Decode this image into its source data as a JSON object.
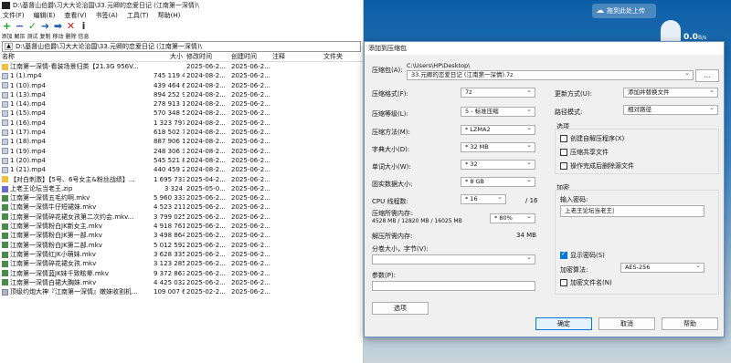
{
  "desktop": {
    "cloud_button": "拖到此处上传",
    "speed_value": "0.0",
    "speed_unit": "B/s"
  },
  "file_manager": {
    "title": "D:\\基督山伯爵\\习大大论治国\\33.元卿的恋爱日记 (江南第一深情)\\",
    "menus": [
      "文件(F)",
      "编辑(E)",
      "查看(V)",
      "书签(A)",
      "工具(T)",
      "帮助(H)"
    ],
    "tools": [
      {
        "label": "添加",
        "icon": "plus-icon",
        "color": "#1a9e1a"
      },
      {
        "label": "解压",
        "icon": "minus-icon",
        "color": "#2a4fb8"
      },
      {
        "label": "测试",
        "icon": "check-icon",
        "color": "#2ea02e"
      },
      {
        "label": "复制",
        "icon": "copy-arrow-icon",
        "color": "#1f5fb0"
      },
      {
        "label": "移动",
        "icon": "move-arrow-icon",
        "color": "#1f5fb0"
      },
      {
        "label": "删除",
        "icon": "delete-icon",
        "color": "#d01818"
      },
      {
        "label": "信息",
        "icon": "info-icon",
        "color": "#333333"
      }
    ],
    "path": "D:\\基督山伯爵\\习大大论治国\\33.元卿的恋爱日记 (江南第一深情)\\",
    "columns": {
      "name": "名称",
      "size": "大小",
      "modified": "修改时间",
      "created": "创建时间",
      "comment": "注释",
      "folders": "文件夹"
    },
    "rows": [
      {
        "icon": "folder",
        "name": "江南第一深情-看装场景归类【21.3G 956V...",
        "size": "",
        "modified": "2025-06-2...",
        "created": "2025-06-2..."
      },
      {
        "icon": "mp4",
        "name": "1 (1).mp4",
        "size": "745 119 4...",
        "modified": "2024-08-2...",
        "created": "2025-06-2..."
      },
      {
        "icon": "mp4",
        "name": "1 (10).mp4",
        "size": "439 464 6...",
        "modified": "2024-08-2...",
        "created": "2025-06-2..."
      },
      {
        "icon": "mp4",
        "name": "1 (13).mp4",
        "size": "894 252 9...",
        "modified": "2024-08-2...",
        "created": "2025-06-2..."
      },
      {
        "icon": "mp4",
        "name": "1 (14).mp4",
        "size": "278 913 1...",
        "modified": "2024-08-2...",
        "created": "2025-06-2..."
      },
      {
        "icon": "mp4",
        "name": "1 (15).mp4",
        "size": "570 348 5...",
        "modified": "2024-08-2...",
        "created": "2025-06-2..."
      },
      {
        "icon": "mp4",
        "name": "1 (16).mp4",
        "size": "1 323 797 ...",
        "modified": "2024-08-2...",
        "created": "2025-06-2..."
      },
      {
        "icon": "mp4",
        "name": "1 (17).mp4",
        "size": "618 502 7...",
        "modified": "2024-08-2...",
        "created": "2025-06-2..."
      },
      {
        "icon": "mp4",
        "name": "1 (18).mp4",
        "size": "887 906 1...",
        "modified": "2024-08-2...",
        "created": "2025-06-2..."
      },
      {
        "icon": "mp4",
        "name": "1 (19).mp4",
        "size": "248 306 3...",
        "modified": "2024-08-2...",
        "created": "2025-06-2..."
      },
      {
        "icon": "mp4",
        "name": "1 (20).mp4",
        "size": "545 521 8...",
        "modified": "2024-08-2...",
        "created": "2025-06-2..."
      },
      {
        "icon": "mp4",
        "name": "1 (21).mp4",
        "size": "440 459 2...",
        "modified": "2024-08-2...",
        "created": "2025-06-2..."
      },
      {
        "icon": "folder",
        "name": "【对白刺激】【5号、6号女主&粉丝战绩】...",
        "size": "1 695 733 ...",
        "modified": "2025-04-2...",
        "created": "2025-06-2..."
      },
      {
        "icon": "zip",
        "name": "上老王论坛当老王.zip",
        "size": "3 324",
        "modified": "2025-05-0...",
        "created": "2025-06-2..."
      },
      {
        "icon": "mkv",
        "name": "江南第一深情五毛约啊.mkv",
        "size": "5 960 333 ...",
        "modified": "2025-06-2...",
        "created": "2025-06-2..."
      },
      {
        "icon": "mkv",
        "name": "江南第一深情牛仔短裙妹.mkv",
        "size": "4 523 211 ...",
        "modified": "2025-06-2...",
        "created": "2025-06-2..."
      },
      {
        "icon": "mkv",
        "name": "江南第一深情碎花裙女孩第二次约会.mkv...",
        "size": "3 799 025 ...",
        "modified": "2025-06-2...",
        "created": "2025-06-2..."
      },
      {
        "icon": "mkv",
        "name": "江南第一深情粉白JK新女主.mkv",
        "size": "4 918 761 ...",
        "modified": "2025-06-2...",
        "created": "2025-06-2..."
      },
      {
        "icon": "mkv",
        "name": "江南第一深情粉白JK第一部.mkv",
        "size": "3 498 864 ...",
        "modified": "2025-06-2...",
        "created": "2025-06-2..."
      },
      {
        "icon": "mkv",
        "name": "江南第一深情粉白JK第二部.mkv",
        "size": "5 012 592 ...",
        "modified": "2025-06-2...",
        "created": "2025-06-2..."
      },
      {
        "icon": "mkv",
        "name": "江南第一深情红JK小萌妹.mkv",
        "size": "3 628 335 ...",
        "modified": "2025-06-2...",
        "created": "2025-06-2..."
      },
      {
        "icon": "mkv",
        "name": "江南第一深情碎花裙女孩.mkv",
        "size": "3 123 285 ...",
        "modified": "2025-06-2...",
        "created": "2025-06-2..."
      },
      {
        "icon": "mkv",
        "name": "江南第一深情蓝JK妹千致眩晕.mkv",
        "size": "9 372 863 ...",
        "modified": "2025-06-2...",
        "created": "2025-06-2..."
      },
      {
        "icon": "mkv",
        "name": "江南第一深情白裙大胸妹.mkv",
        "size": "4 425 032 ...",
        "modified": "2025-06-2...",
        "created": "2025-06-2..."
      },
      {
        "icon": "gen",
        "name": "顶级约炮大神『江南第一深情』嫩妹收割机...",
        "size": "109 007 6...",
        "modified": "2025-02-2...",
        "created": "2025-06-2..."
      }
    ]
  },
  "dialog": {
    "title": "添加到压缩包",
    "archive_label": "压缩包(A):",
    "archive_dir": "C:\\Users\\HP\\Desktop\\",
    "archive_value": "33.元卿的恋爱日记 (江南第一深情).7z",
    "browse": "...",
    "format_label": "压缩格式(F):",
    "format_value": "7z",
    "level_label": "压缩等级(L):",
    "level_value": "5 - 标准压缩",
    "method_label": "压缩方法(M):",
    "method_value": "* LZMA2",
    "dict_label": "字典大小(D):",
    "dict_value": "* 32 MB",
    "word_label": "单词大小(W):",
    "word_value": "* 32",
    "solid_label": "固实数据大小:",
    "solid_value": "* 8 GB",
    "threads_label": "CPU 线程数:",
    "threads_value": "* 16",
    "threads_total": "/ 16",
    "mem_label": "压缩所需内存:",
    "mem_detail": "4528 MB / 12820 MB / 16025 MB",
    "mem_percent": "* 80%",
    "decomp_label": "解压所需内存:",
    "decomp_value": "34 MB",
    "split_label": "分卷大小，字节(V):",
    "params_label": "参数(P):",
    "options_button": "选项",
    "update_label": "更新方式(U):",
    "update_value": "添加并替换文件",
    "pathmode_label": "路径模式:",
    "pathmode_value": "相对路径",
    "options_group": "选项",
    "opt_sfx": "创建自解压程序(X)",
    "opt_shared": "压缩共享文件",
    "opt_delete": "操作完成后删除源文件",
    "encrypt_group": "加密",
    "password_label": "输入密码:",
    "password_value": "上老王论坛当老王|",
    "show_password": "显示密码(S)",
    "enc_method_label": "加密算法:",
    "enc_method_value": "AES-256",
    "encrypt_names": "加密文件名(N)",
    "ok": "确定",
    "cancel": "取消",
    "help": "帮助"
  }
}
